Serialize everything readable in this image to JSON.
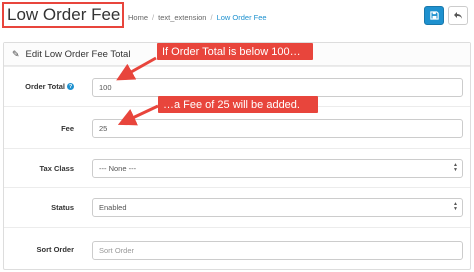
{
  "header": {
    "title": "Low Order Fee",
    "breadcrumb": [
      "Home",
      "text_extension",
      "Low Order Fee"
    ],
    "save_icon": "save-icon",
    "back_icon": "reply-icon",
    "accent": "#1e91cf"
  },
  "panel": {
    "heading": "Edit Low Order Fee Total",
    "heading_icon": "pencil-icon"
  },
  "form": {
    "order_total": {
      "label": "Order Total",
      "value": "100"
    },
    "fee": {
      "label": "Fee",
      "value": "25"
    },
    "tax_class": {
      "label": "Tax Class",
      "value": "--- None ---"
    },
    "status": {
      "label": "Status",
      "value": "Enabled"
    },
    "sort_order": {
      "label": "Sort Order",
      "placeholder": "Sort Order"
    }
  },
  "annotations": {
    "callout_1": "If Order Total is below 100…",
    "callout_2": "…a Fee of 25 will be added.",
    "color": "#e8453c"
  }
}
